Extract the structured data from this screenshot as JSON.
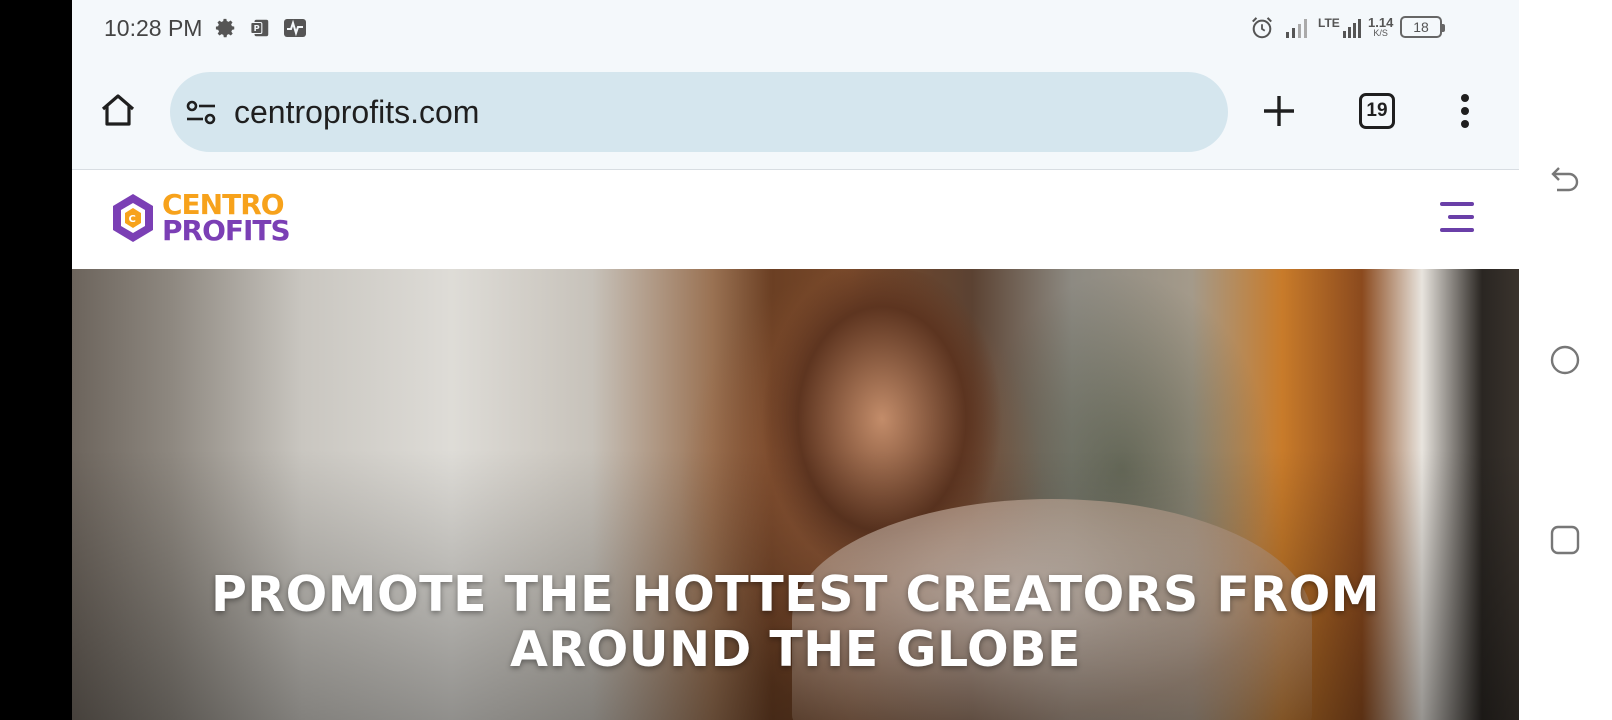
{
  "status_bar": {
    "time": "10:28 PM",
    "left_icons": [
      "settings-icon",
      "powerpoint-icon",
      "activity-icon"
    ],
    "right_icons": [
      "alarm-icon",
      "signal-icon",
      "lte-signal-icon"
    ],
    "network_label": "LTE",
    "network_speed_value": "1.14",
    "network_speed_unit": "K/S",
    "battery_level": "18"
  },
  "browser": {
    "url": "centroprofits.com",
    "tab_count": "19",
    "icons": [
      "home-icon",
      "site-settings-icon",
      "new-tab-icon",
      "tab-switcher-icon",
      "more-menu-icon"
    ]
  },
  "site": {
    "logo_line1": "CENTRO",
    "logo_line2": "PROFITS",
    "hero_title_line1": "PROMOTE THE HOTTEST CREATORS FROM",
    "hero_title_line2": "AROUND THE GLOBE"
  },
  "colors": {
    "logo_orange": "#f7a21b",
    "logo_purple": "#7b3fb5",
    "url_bar": "#d5e6ee",
    "toolbar_bg": "#f4f8fb"
  },
  "system_nav": {
    "icons": [
      "back-icon",
      "home-circle-icon",
      "recents-icon"
    ]
  }
}
